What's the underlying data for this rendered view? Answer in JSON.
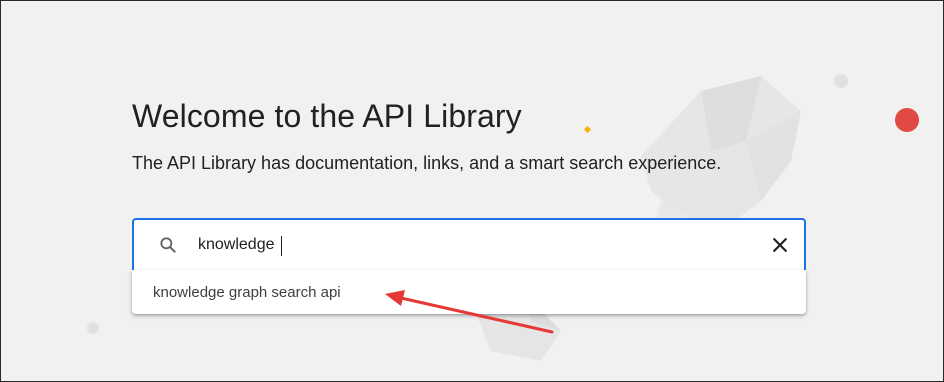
{
  "page": {
    "title": "Welcome to the API Library",
    "subtitle": "The API Library has documentation, links, and a smart search experience."
  },
  "search": {
    "value": "knowledge",
    "icon": "search-icon",
    "clear_icon": "close-icon"
  },
  "suggestions": [
    {
      "label": "knowledge graph search api"
    }
  ],
  "annotation": {
    "color": "#e53935"
  },
  "colors": {
    "background": "#f1f1f1",
    "accent": "#1a73e8",
    "red_dot": "#e04a43",
    "yellow_dot": "#f4b400"
  }
}
